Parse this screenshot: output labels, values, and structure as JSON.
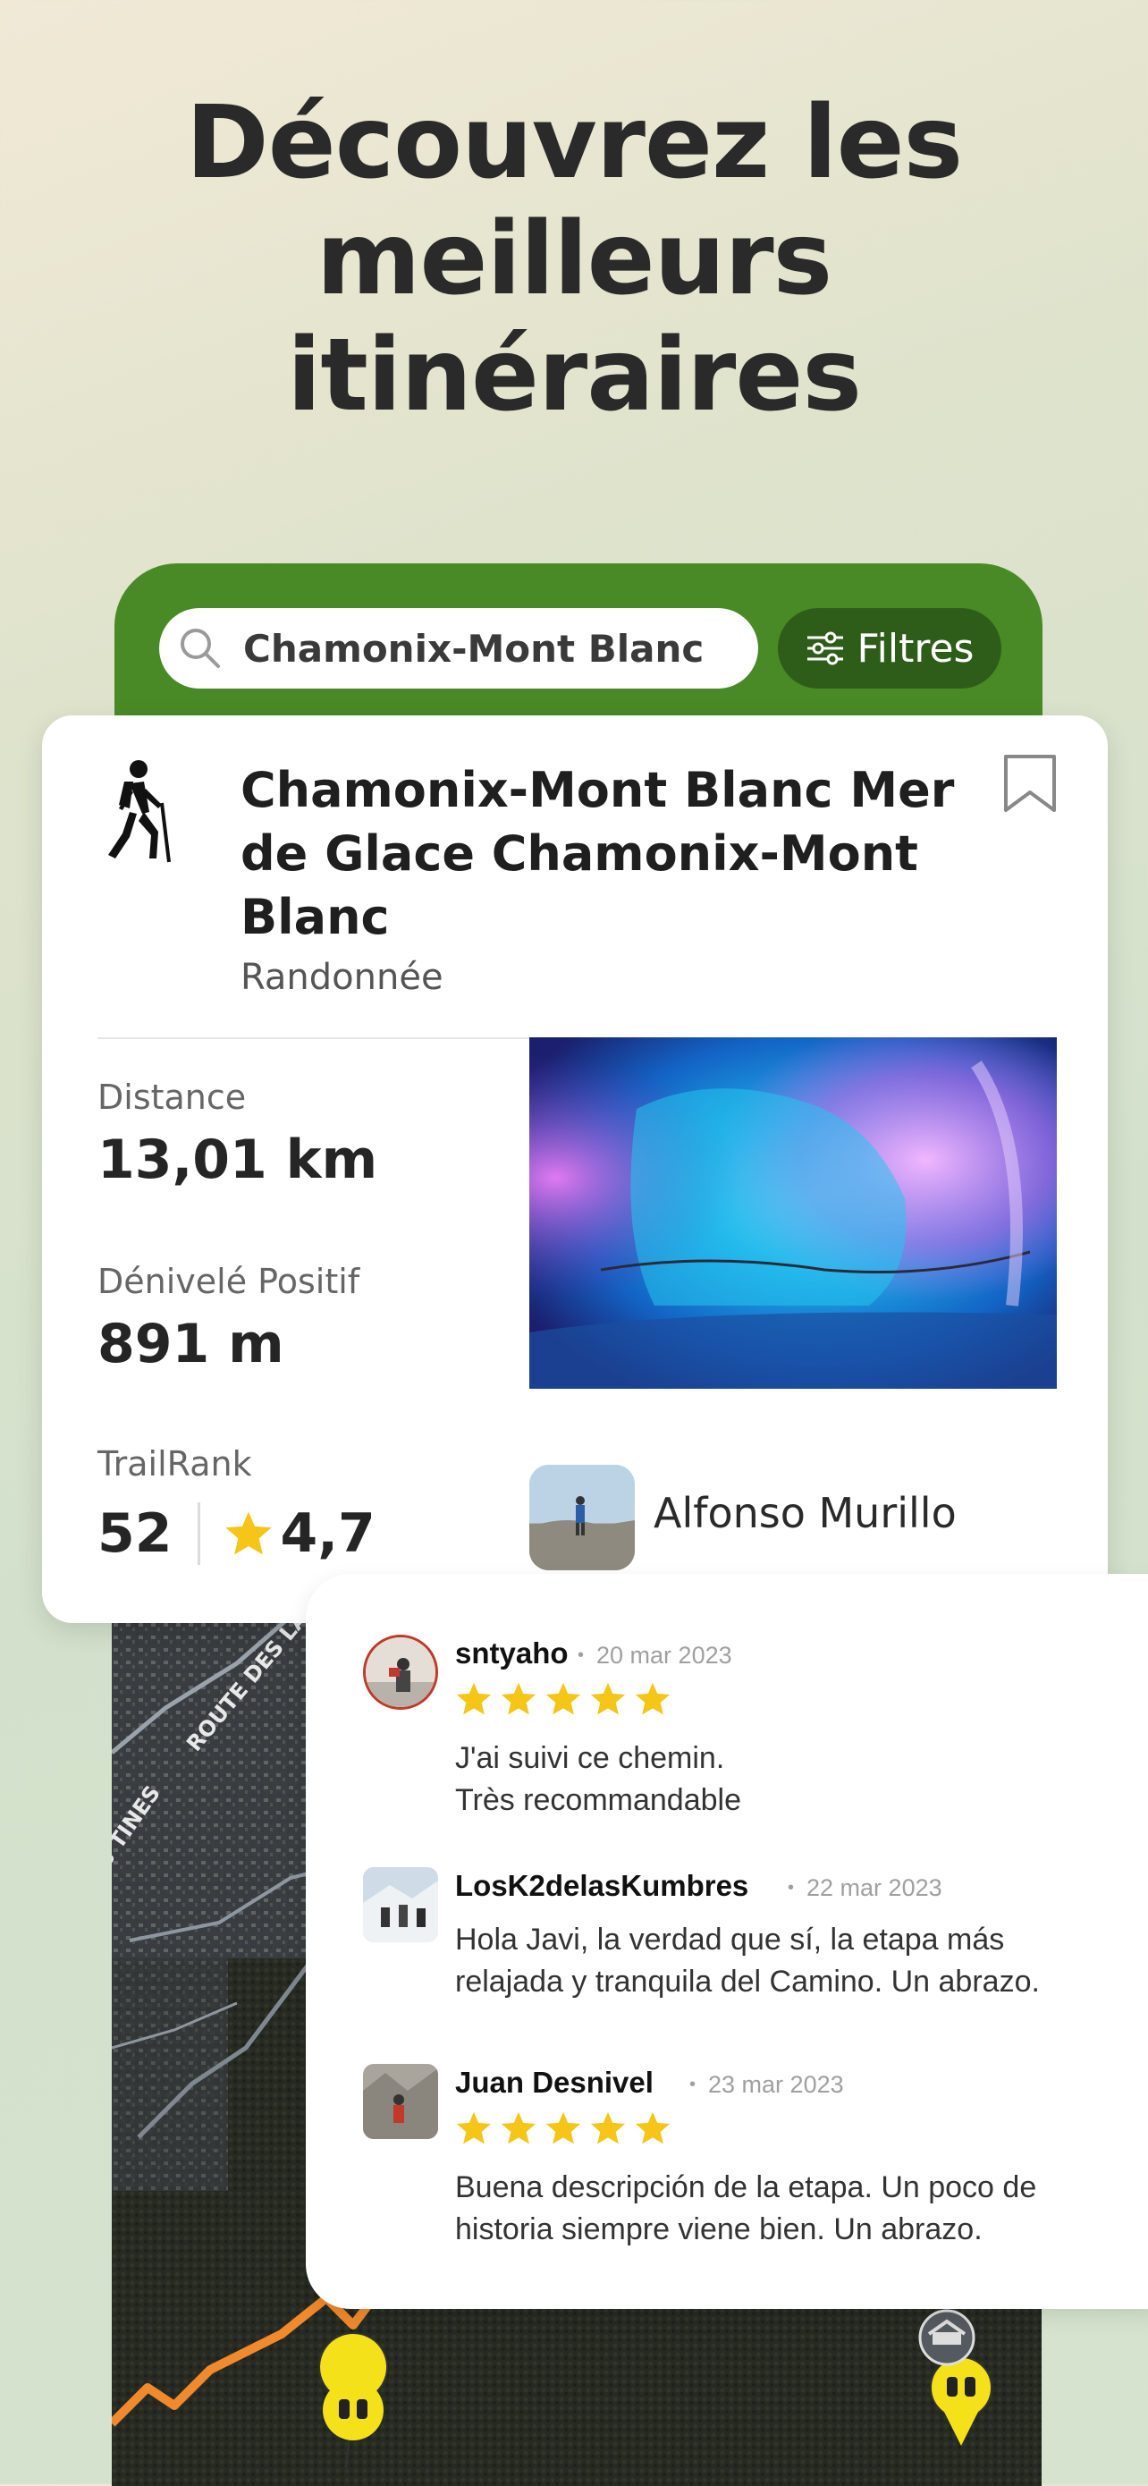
{
  "headline": {
    "line1": "Découvrez les",
    "line2": "meilleurs",
    "line3": "itinéraires"
  },
  "search": {
    "value": "Chamonix-Mont Blanc",
    "filter_label": "Filtres"
  },
  "trail": {
    "title": "Chamonix-Mont Blanc Mer de Glace Chamonix-Mont Blanc",
    "activity": "Randonnée",
    "distance_label": "Distance",
    "distance_value": "13,01 km",
    "elevation_label": "Dénivelé Positif",
    "elevation_value": "891 m",
    "trailrank_label": "TrailRank",
    "trailrank_value": "52",
    "rating": "4,7",
    "author": "Alfonso Murillo"
  },
  "reviews": [
    {
      "user": "sntyaho",
      "date": "20 mar 2023",
      "stars": 5,
      "text_line1": "J'ai suivi ce chemin.",
      "text_line2": "Très recommandable"
    },
    {
      "user": "LosK2delasKumbres",
      "date": "22 mar 2023",
      "stars": 0,
      "text_line1": "Hola Javi, la verdad que sí, la etapa más",
      "text_line2": "relajada y tranquila del Camino. Un abrazo."
    },
    {
      "user": "Juan Desnivel",
      "date": "23 mar 2023",
      "stars": 5,
      "text_line1": "Buena descripción de la etapa. Un poco de",
      "text_line2": "historia siempre viene bien. Un abrazo."
    }
  ],
  "map": {
    "label_road": "ROUTE DES LACS",
    "label_tines": "S TINES"
  },
  "colors": {
    "brand_green": "#4a8a26",
    "brand_dark_green": "#2e5d1a",
    "star_yellow": "#f5c518",
    "route_orange": "#f08a2c"
  }
}
